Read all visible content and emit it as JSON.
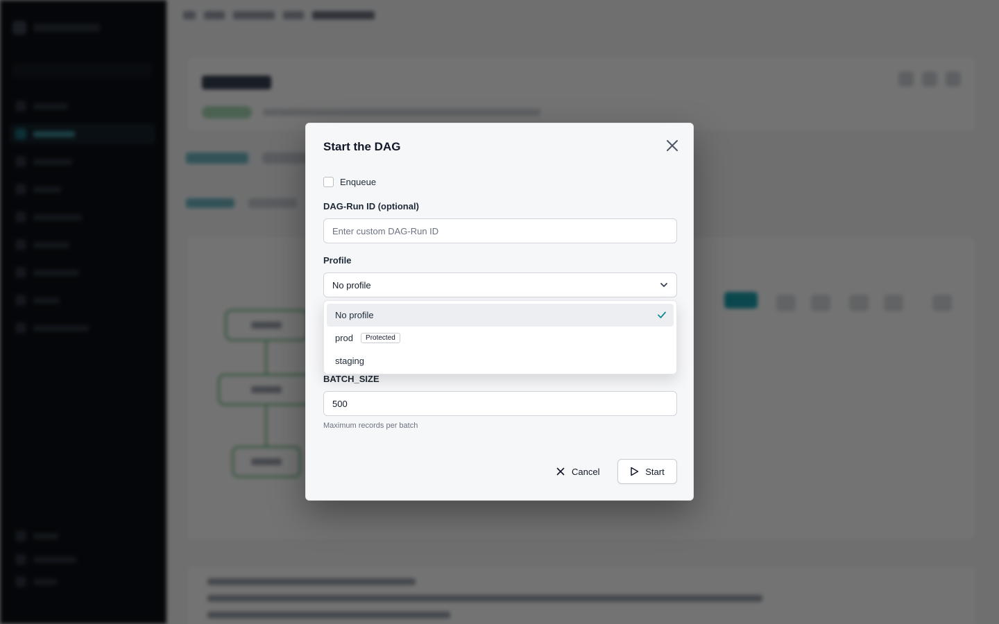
{
  "modal": {
    "title": "Start the DAG",
    "enqueue_label": "Enqueue",
    "enqueue_checked": false,
    "run_id": {
      "label": "DAG-Run ID (optional)",
      "placeholder": "Enter custom DAG-Run ID",
      "value": ""
    },
    "profile": {
      "label": "Profile",
      "selected": "No profile",
      "options": [
        {
          "label": "No profile",
          "selected": true
        },
        {
          "label": "prod",
          "badge": "Protected"
        },
        {
          "label": "staging"
        }
      ]
    },
    "batch_size": {
      "label": "BATCH_SIZE",
      "value": "500",
      "hint": "Maximum records per batch"
    },
    "cancel_label": "Cancel",
    "start_label": "Start"
  },
  "icons": {
    "close": "close-icon",
    "chevron": "chevron-down-icon",
    "check": "check-icon",
    "cancel": "x-icon",
    "start": "play-icon"
  },
  "colors": {
    "overlay": "#000000",
    "accent": "#1aa0ae",
    "check": "#0e8a96",
    "status_success": "#7cc18e"
  }
}
